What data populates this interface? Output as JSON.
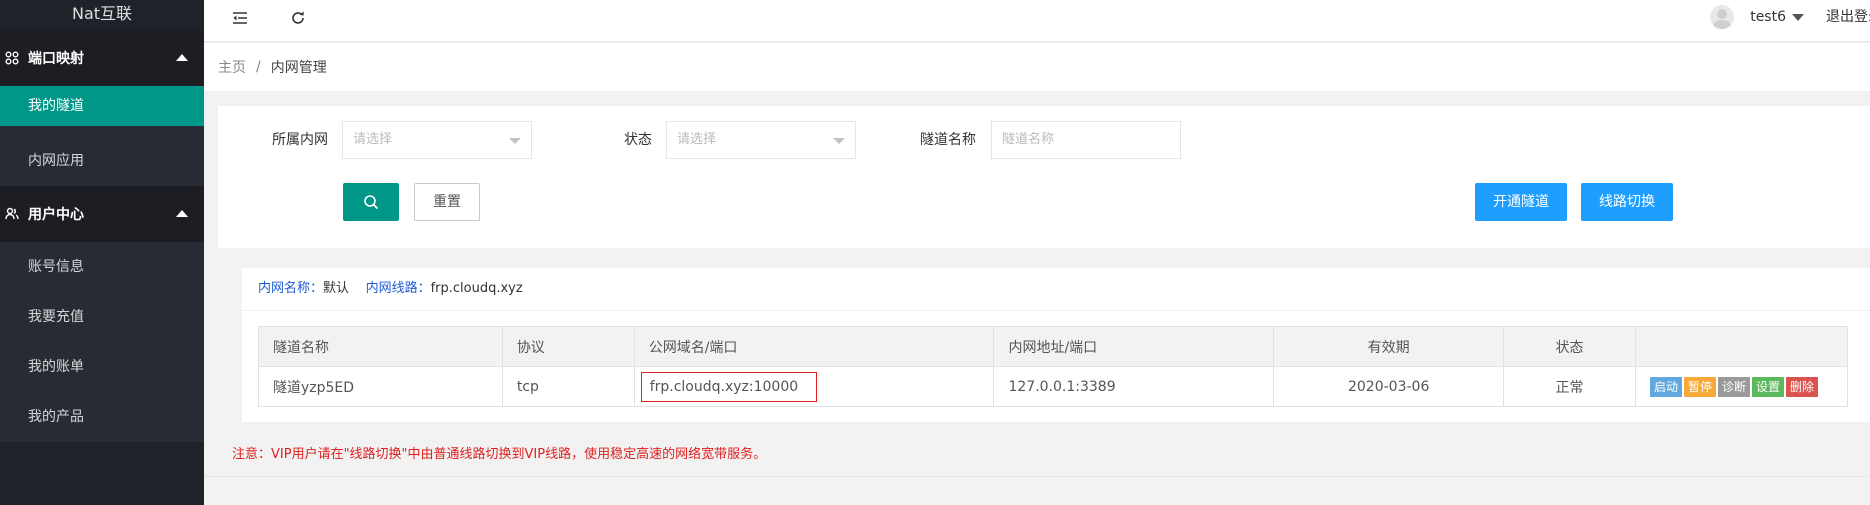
{
  "sidebar": {
    "logo": "Nat互联",
    "groups": [
      {
        "label": "端口映射",
        "icon": "grid-icon",
        "items": [
          {
            "label": "我的隧道",
            "active": true
          },
          {
            "label": "内网应用",
            "active": false
          }
        ]
      },
      {
        "label": "用户中心",
        "icon": "users-icon",
        "items": [
          {
            "label": "账号信息"
          },
          {
            "label": "我要充值"
          },
          {
            "label": "我的账单"
          },
          {
            "label": "我的产品"
          }
        ]
      }
    ]
  },
  "header": {
    "username": "test6",
    "logout": "退出登录"
  },
  "breadcrumb": {
    "home": "主页",
    "separator": "/",
    "current": "内网管理"
  },
  "filter": {
    "network_label": "所属内网",
    "network_placeholder": "请选择",
    "status_label": "状态",
    "status_placeholder": "请选择",
    "name_label": "隧道名称",
    "name_placeholder": "隧道名称",
    "reset": "重置",
    "open_tunnel": "开通隧道",
    "switch_line": "线路切换"
  },
  "network_info": {
    "name_key": "内网名称：",
    "name_value": "默认",
    "line_key": "内网线路：",
    "line_value": "frp.cloudq.xyz"
  },
  "table": {
    "headers": [
      "隧道名称",
      "协议",
      "公网域名/端口",
      "内网地址/端口",
      "有效期",
      "状态",
      ""
    ],
    "rows": [
      {
        "name": "隧道yzp5ED",
        "protocol": "tcp",
        "public": "frp.cloudq.xyz:10000",
        "local": "127.0.0.1:3389",
        "expiry": "2020-03-06",
        "status": "正常",
        "ops": [
          "启动",
          "暂停",
          "诊断",
          "设置",
          "删除"
        ]
      }
    ]
  },
  "notice": "注意：VIP用户请在\"线路切换\"中由普通线路切换到VIP线路，使用稳定高速的网络宽带服务。",
  "colors": {
    "sidebar_bg": "#20222a",
    "active": "#009688",
    "primary_blue": "#1e9fff",
    "highlight_red": "#e02020"
  }
}
